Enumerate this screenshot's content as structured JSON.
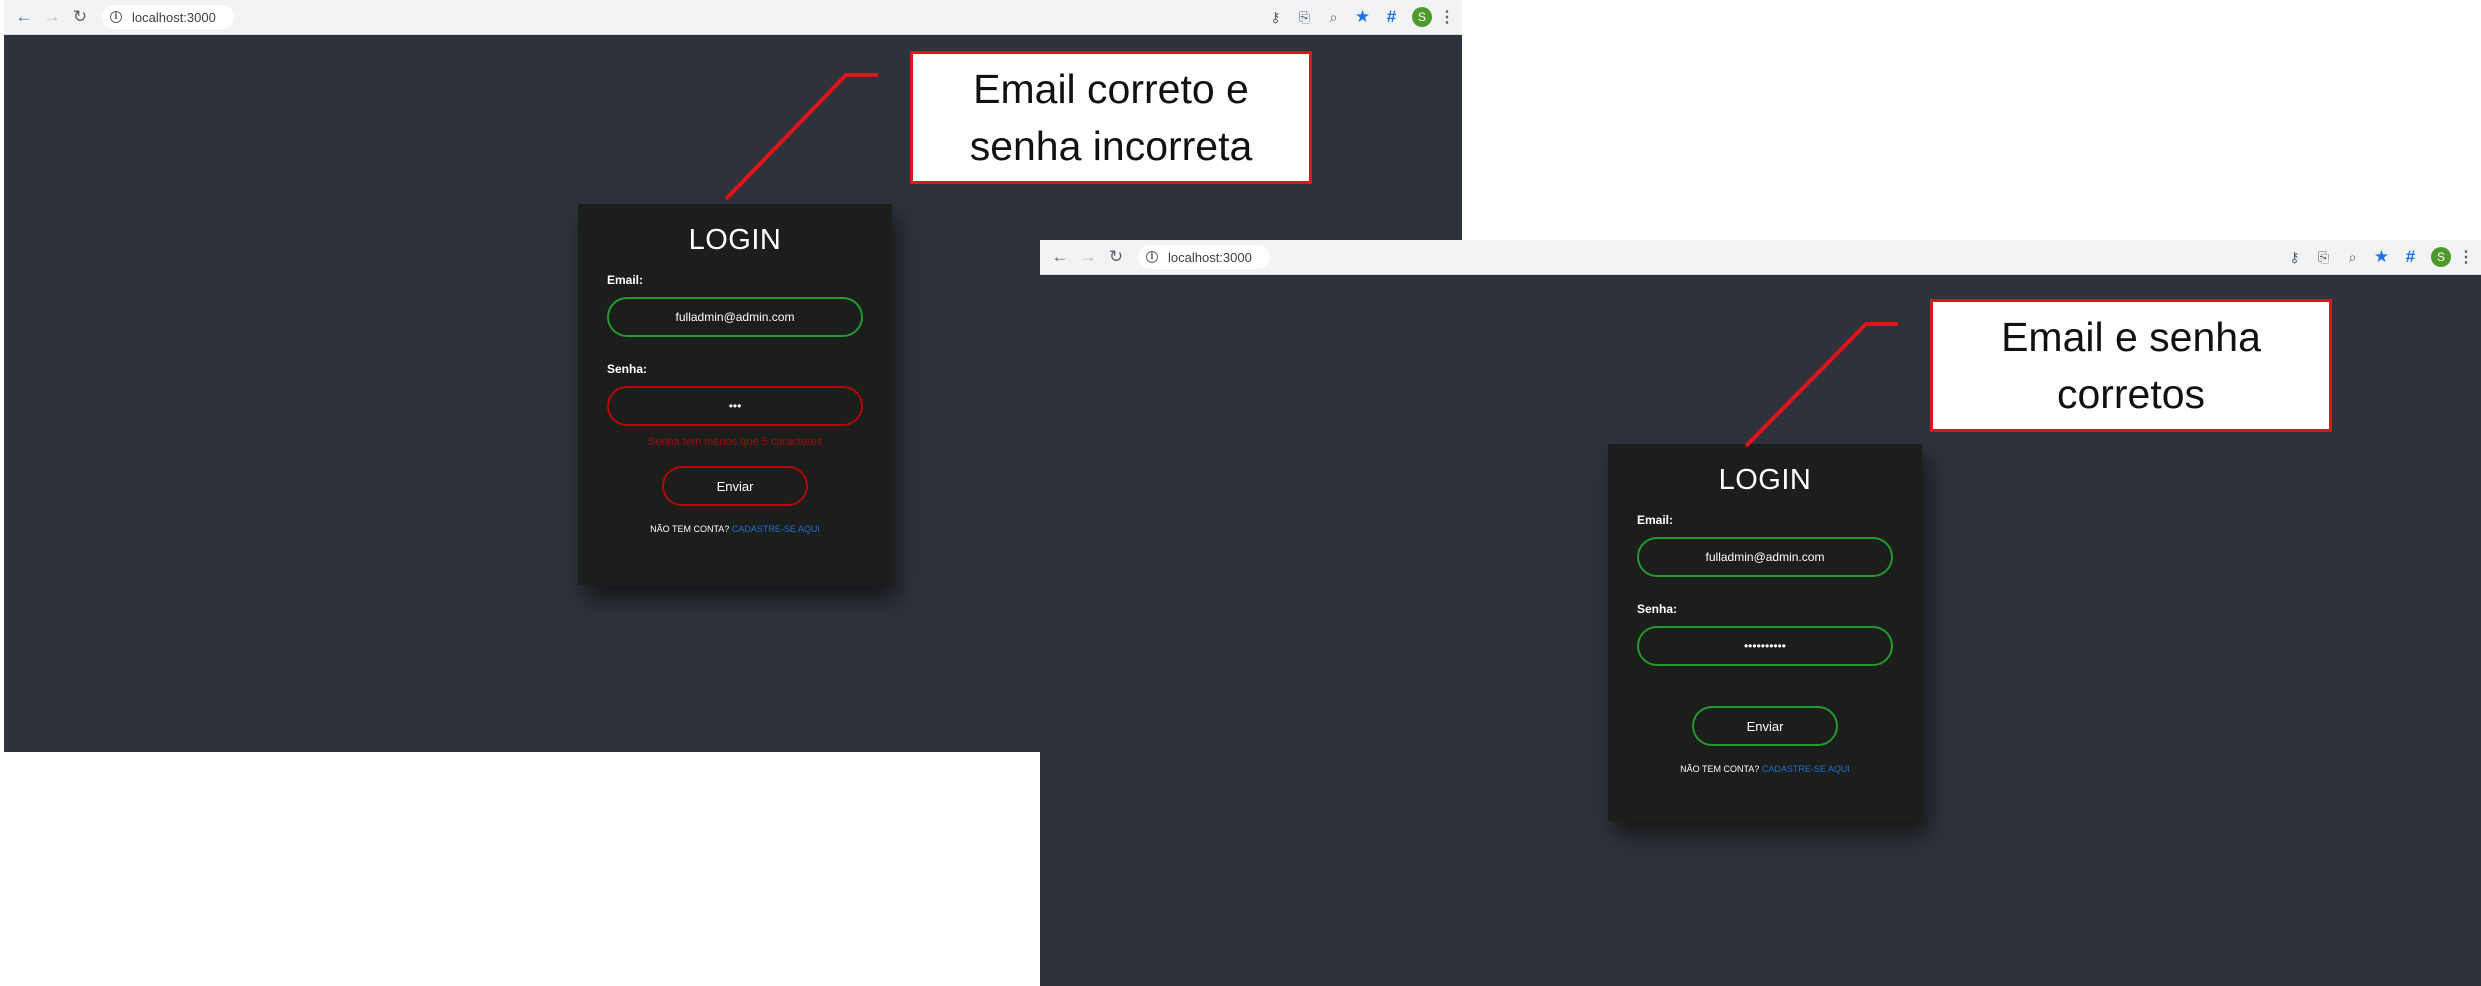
{
  "browser": {
    "url": "localhost:3000",
    "avatar_letter": "S"
  },
  "colors": {
    "page_bg": "#2f323a",
    "card_bg": "#1c1e1b",
    "valid_border": "#23992f",
    "invalid_border": "#b3070a",
    "link": "#1f6fd1",
    "callout_border": "#e0141b"
  },
  "screens": [
    {
      "callout": [
        "Email correto e",
        "senha incorreta"
      ],
      "login": {
        "title": "LOGIN",
        "email_label": "Email:",
        "email_value": "fulladmin@admin.com",
        "password_label": "Senha:",
        "password_mask": "•••",
        "error": "Senha tem menos que 5 caracteres",
        "submit": "Enviar",
        "signup_prompt": "NÃO TEM CONTA?",
        "signup_link": "CADASTRE-SE AQUI"
      }
    },
    {
      "callout": [
        "Email e senha",
        "corretos"
      ],
      "login": {
        "title": "LOGIN",
        "email_label": "Email:",
        "email_value": "fulladmin@admin.com",
        "password_label": "Senha:",
        "password_mask": "••••••••••",
        "error": "",
        "submit": "Enviar",
        "signup_prompt": "NÃO TEM CONTA?",
        "signup_link": "CADASTRE-SE AQUI"
      }
    }
  ]
}
